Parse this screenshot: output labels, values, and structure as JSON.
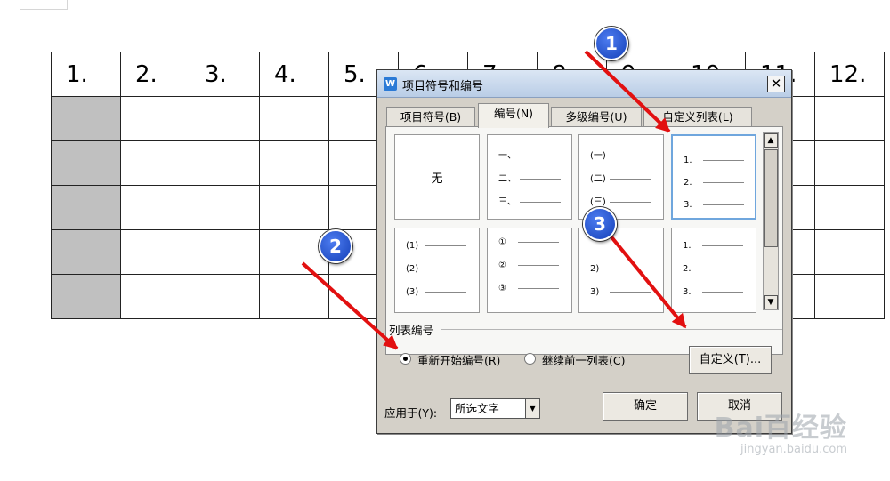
{
  "table": {
    "headers": [
      "1.",
      "2.",
      "3.",
      "4.",
      "5.",
      "6.",
      "7.",
      "8.",
      "9.",
      "10.",
      "11.",
      "12."
    ],
    "body_rows": 5
  },
  "dialog": {
    "title": "项目符号和编号",
    "app_icon": "W",
    "close_label": "✕",
    "tabs": [
      {
        "label": "项目符号(B)",
        "active": false
      },
      {
        "label": "编号(N)",
        "active": true
      },
      {
        "label": "多级编号(U)",
        "active": false
      },
      {
        "label": "自定义列表(L)",
        "active": false
      }
    ],
    "styles": {
      "none_label": "无",
      "chinese": [
        "一、",
        "二、",
        "三、"
      ],
      "paren_chinese": [
        "(一)",
        "(二)",
        "(三)"
      ],
      "arabic_dot": [
        "1.",
        "2.",
        "3."
      ],
      "paren_arabic": [
        "(1)",
        "(2)",
        "(3)"
      ],
      "circled": [
        "①",
        "②",
        "③"
      ],
      "right_paren": [
        "2)",
        "3)"
      ],
      "arabic_dot_2": [
        "1.",
        "2.",
        "3."
      ]
    },
    "section_label": "列表编号",
    "radio_restart": "重新开始编号(R)",
    "radio_continue": "继续前一列表(C)",
    "customize_button": "自定义(T)...",
    "apply_label": "应用于(Y):",
    "apply_value": "所选文字",
    "ok_button": "确定",
    "cancel_button": "取消"
  },
  "annotations": {
    "badges": [
      "1",
      "2",
      "3"
    ],
    "arrow_color": "#e21010"
  },
  "watermark": {
    "logo": "Bai百经验",
    "url": "jingyan.baidu.com"
  }
}
